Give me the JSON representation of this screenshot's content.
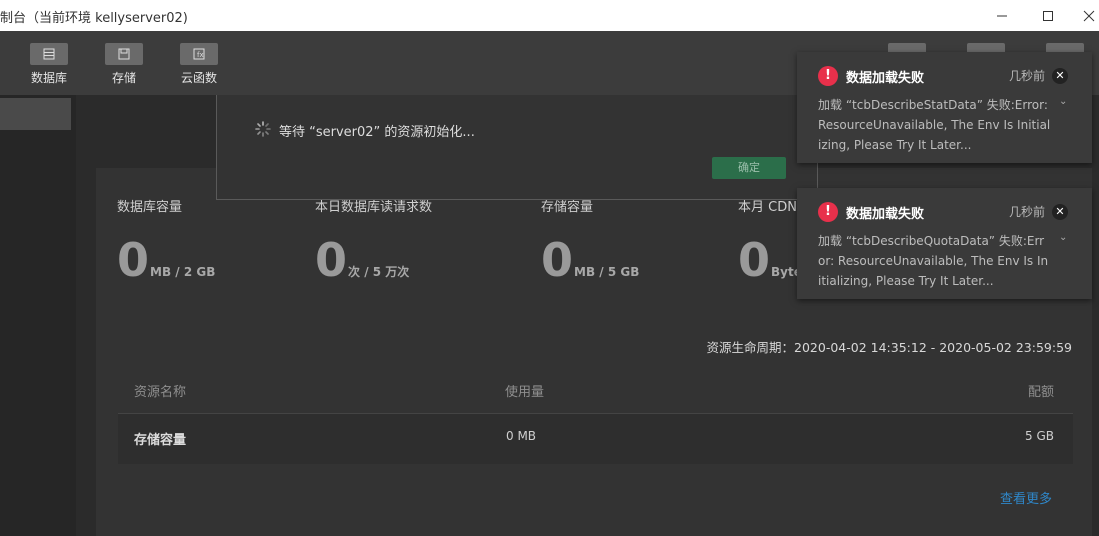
{
  "window": {
    "title": "制台（当前环境 kellyserver02)"
  },
  "toolbar": {
    "items": [
      {
        "label": "数据库",
        "icon": "database-icon"
      },
      {
        "label": "存储",
        "icon": "storage-icon"
      },
      {
        "label": "云函数",
        "icon": "function-icon"
      }
    ]
  },
  "stats": [
    {
      "label": "数据库容量",
      "value": "0",
      "unit": "MB / 2 GB"
    },
    {
      "label": "本日数据库读请求数",
      "value": "0",
      "unit": "次 / 5 万次"
    },
    {
      "label": "存储容量",
      "value": "0",
      "unit": "MB / 5 GB"
    },
    {
      "label": "本月 CDN",
      "value": "0",
      "unit": "Byte"
    }
  ],
  "period": {
    "text": "资源生命周期：2020-04-02 14:35:12 - 2020-05-02 23:59:59"
  },
  "table": {
    "headers": [
      "资源名称",
      "使用量",
      "配额"
    ],
    "rows": [
      {
        "name": "存储容量",
        "usage": "0 MB",
        "quota": "5 GB"
      }
    ],
    "more": "查看更多"
  },
  "modal": {
    "message": "等待 “server02” 的资源初始化...",
    "ok": "确定"
  },
  "toasts": [
    {
      "title": "数据加载失败",
      "time": "几秒前",
      "body": "加载 “tcbDescribeStatData” 失败:Error: ResourceUnavailable, The Env Is Initializing, Please Try It Later..."
    },
    {
      "title": "数据加载失败",
      "time": "几秒前",
      "body": "加载 “tcbDescribeQuotaData” 失败:Error: ResourceUnavailable, The Env Is Initializing, Please Try It Later..."
    }
  ],
  "colors": {
    "accent": "#2b6e4a",
    "error": "#e8304b",
    "link": "#2f87c9"
  }
}
